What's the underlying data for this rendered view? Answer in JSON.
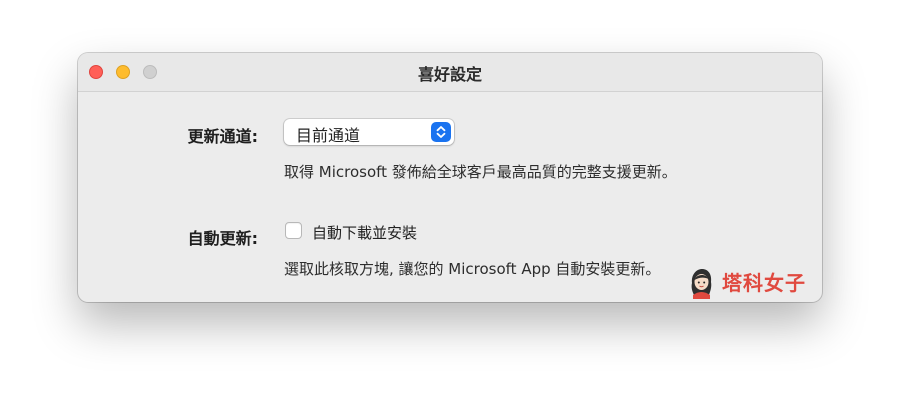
{
  "window": {
    "title": "喜好設定"
  },
  "update_channel": {
    "label": "更新通道:",
    "selected_option": "目前通道",
    "description": "取得 Microsoft 發佈給全球客戶最高品質的完整支援更新。"
  },
  "auto_update": {
    "label": "自動更新:",
    "checkbox_label": "自動下載並安裝",
    "checked": false,
    "description": "選取此核取方塊, 讓您的 Microsoft App 自動安裝更新。"
  },
  "watermark": {
    "text": "塔科女子"
  },
  "colors": {
    "close": "#ff5f57",
    "minimize": "#febc2e",
    "zoom_inactive": "#d0d0d0",
    "accent": "#1a73f0",
    "watermark": "#e0493f"
  },
  "icons": {
    "popup_arrows": "up-down-chevron-icon",
    "watermark_avatar": "avatar-icon"
  }
}
